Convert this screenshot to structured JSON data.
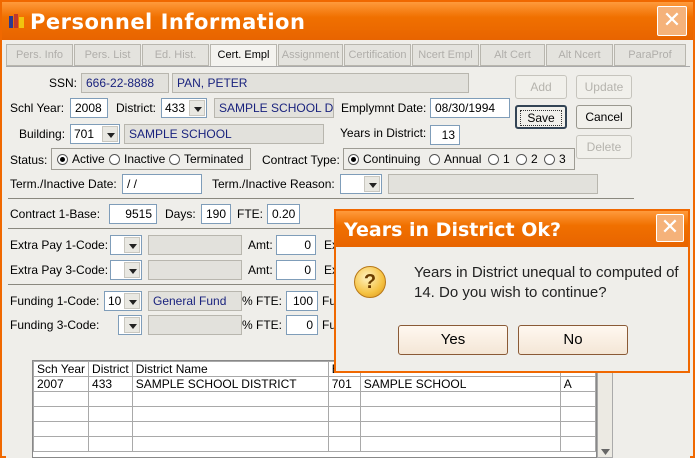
{
  "window": {
    "title": "Personnel Information",
    "close_glyph": "✕"
  },
  "tabs": [
    {
      "label": "Pers. Info"
    },
    {
      "label": "Pers. List"
    },
    {
      "label": "Ed. Hist."
    },
    {
      "label": "Cert. Empl",
      "active": true
    },
    {
      "label": "Assignment"
    },
    {
      "label": "Certification"
    },
    {
      "label": "Ncert Empl"
    },
    {
      "label": "Alt Cert"
    },
    {
      "label": "Alt Ncert"
    },
    {
      "label": "ParaProf"
    }
  ],
  "form": {
    "ssn_label": "SSN:",
    "ssn": "666-22-8888",
    "name": "PAN, PETER",
    "schl_year_label": "Schl Year:",
    "schl_year": "2008",
    "district_label": "District:",
    "district_code": "433",
    "district_name": "SAMPLE SCHOOL D",
    "emp_date_label": "Emplymnt Date:",
    "emp_date": "08/30/1994",
    "building_label": "Building:",
    "building_code": "701",
    "building_name": "SAMPLE SCHOOL",
    "years_label": "Years in District:",
    "years": "13",
    "status_label": "Status:",
    "status_options": [
      "Active",
      "Inactive",
      "Terminated"
    ],
    "contract_type_label": "Contract Type:",
    "contract_options": [
      "Continuing",
      "Annual",
      "1",
      "2",
      "3"
    ],
    "term_date_label": "Term./Inactive Date:",
    "term_date": " / /",
    "term_reason_label": "Term./Inactive Reason:",
    "contract1_label": "Contract 1-Base:",
    "contract1_base": "9515",
    "days_label": "Days:",
    "days": "190",
    "fte_label": "FTE:",
    "fte": "0.20",
    "extra1_label": "Extra Pay 1-Code:",
    "extra3_label": "Extra Pay 3-Code:",
    "amt_label": "Amt:",
    "amt1": "0",
    "amt3": "0",
    "ex_stub": "Ex",
    "funding1_label": "Funding 1-Code:",
    "funding1_code": "10",
    "funding1_name": "General Fund",
    "funding3_label": "Funding 3-Code:",
    "pct_fte_label": "% FTE:",
    "pct_fte1": "100",
    "pct_fte3": "0",
    "fu_stub": "Fu"
  },
  "buttons": {
    "add": "Add",
    "update": "Update",
    "save": "Save",
    "cancel": "Cancel",
    "delete": "Delete"
  },
  "grid": {
    "headers": [
      "Sch Year",
      "District",
      "District Name",
      "B",
      "",
      ""
    ],
    "rows": [
      [
        "2007",
        "433",
        "SAMPLE SCHOOL DISTRICT",
        "701",
        "SAMPLE SCHOOL",
        "A"
      ]
    ]
  },
  "dialog": {
    "title": "Years in District Ok?",
    "close_glyph": "✕",
    "message": "Years in District unequal to computed of 14. Do you wish to continue?",
    "yes": "Yes",
    "no": "No",
    "icon": "question-icon"
  },
  "colors": {
    "titlebar": "#f07000",
    "border": "#f06800",
    "readonly_text": "#1a237e"
  }
}
